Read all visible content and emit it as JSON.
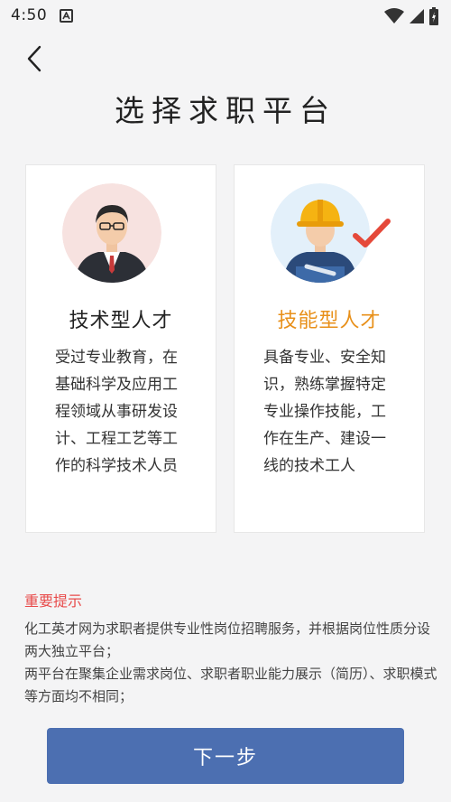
{
  "status_bar": {
    "time": "4:50",
    "notification_icon": "a-icon",
    "wifi_icon": "wifi-icon",
    "signal_icon": "signal-icon",
    "battery_icon": "battery-charging-icon"
  },
  "header": {
    "back_icon": "back-icon"
  },
  "page": {
    "title": "选择求职平台"
  },
  "cards": [
    {
      "title": "技术型人才",
      "title_color": "#222222",
      "description": "受过专业教育，在基础科学及应用工程领域从事研发设计、工程工艺等工作的科学技术人员",
      "icon": "businessman-avatar-icon",
      "selected": false
    },
    {
      "title": "技能型人才",
      "title_color": "#e8901a",
      "description": "具备专业、安全知识，熟练掌握特定专业操作技能，工作在生产、建设一线的技术工人",
      "icon": "worker-avatar-icon",
      "selected": true
    }
  ],
  "notice": {
    "title": "重要提示",
    "title_color": "#e84b4b",
    "body_1": "化工英才网为求职者提供专业性岗位招聘服务，并根据岗位性质分设两大独立平台；",
    "body_2": "两平台在聚集企业需求岗位、求职者职业能力展示（简历）、求职模式等方面均不相同；"
  },
  "footer": {
    "next_label": "下一步",
    "button_color": "#4c6fb1"
  }
}
